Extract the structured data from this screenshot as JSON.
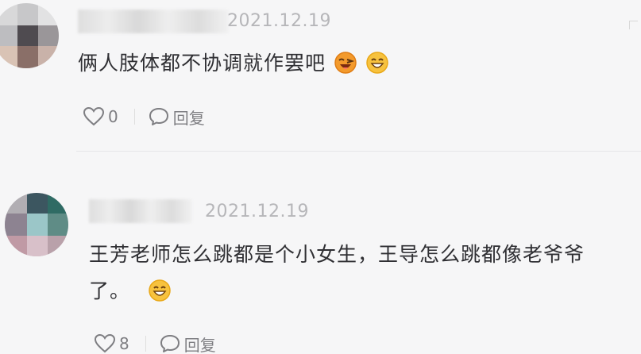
{
  "comments": [
    {
      "date": "2021.12.19",
      "text": "俩人肢体都不协调就作罢吧",
      "emojis": [
        "grinning-wink-icon",
        "smile-icon"
      ],
      "likes": "0",
      "reply_label": "回复"
    },
    {
      "date": "2021.12.19",
      "text_line1": "王芳老师怎么跳都是个小女生，王导怎么跳都像老爷爷",
      "text_line2": "了。",
      "emojis": [
        "smile-icon"
      ],
      "likes": "8",
      "reply_label": "回复"
    }
  ],
  "colors": {
    "text": "#2f2f33",
    "meta": "#b6b6b9",
    "action": "#7e7e82",
    "emoji_yellow": "#f7c23e",
    "emoji_orange": "#f39a2c"
  }
}
